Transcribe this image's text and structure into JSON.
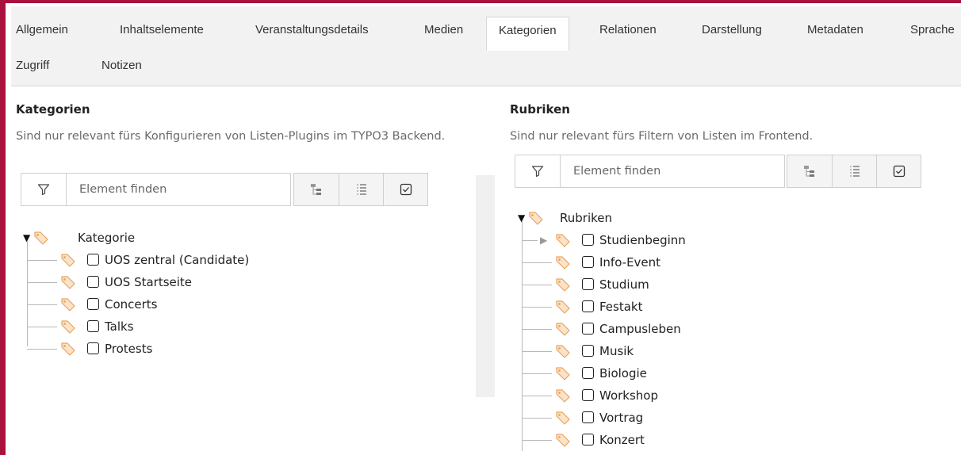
{
  "tabs": [
    {
      "label": "Allgemein"
    },
    {
      "label": "Inhaltselemente"
    },
    {
      "label": "Veranstaltungsdetails"
    },
    {
      "label": "Medien"
    },
    {
      "label": "Kategorien"
    },
    {
      "label": "Relationen"
    },
    {
      "label": "Darstellung"
    },
    {
      "label": "Metadaten"
    },
    {
      "label": "Sprache"
    },
    {
      "label": "Zugriff"
    },
    {
      "label": "Notizen"
    }
  ],
  "active_tab": "Kategorien",
  "left": {
    "title": "Kategorien",
    "description": "Sind nur relevant fürs Konfigurieren von Listen-Plugins im TYPO3 Backend.",
    "filter_placeholder": "Element finden",
    "tree_root": "Kategorie",
    "items": [
      "UOS zentral (Candidate)",
      "UOS Startseite",
      "Concerts",
      "Talks",
      "Protests"
    ]
  },
  "right": {
    "title": "Rubriken",
    "description": "Sind nur relevant fürs Filtern von Listen im Frontend.",
    "filter_placeholder": "Element finden",
    "tree_root": "Rubriken",
    "items": [
      "Studienbeginn",
      "Info-Event",
      "Studium",
      "Festakt",
      "Campusleben",
      "Musik",
      "Biologie",
      "Workshop",
      "Vortrag",
      "Konzert"
    ]
  },
  "icons": {
    "filter": "filter-icon",
    "toggle_tree": "hierarchy-icon",
    "expand_all": "list-icon",
    "show_checked": "checkbox-check-icon",
    "category": "tag-icon"
  },
  "colors": {
    "accent": "#a8123c",
    "tab_bg": "#f2f2f2",
    "tag_icon": "#f0a660"
  }
}
